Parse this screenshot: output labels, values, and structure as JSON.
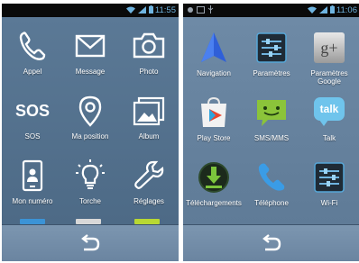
{
  "left_phone": {
    "status_time": "11:55",
    "apps": [
      {
        "label": "Appel",
        "icon": "phone-icon"
      },
      {
        "label": "Message",
        "icon": "envelope-icon"
      },
      {
        "label": "Photo",
        "icon": "camera-icon"
      },
      {
        "label": "SOS",
        "icon": "sos-icon"
      },
      {
        "label": "Ma position",
        "icon": "location-pin-icon"
      },
      {
        "label": "Album",
        "icon": "album-icon"
      },
      {
        "label": "Mon numéro",
        "icon": "contact-card-icon"
      },
      {
        "label": "Torche",
        "icon": "lightbulb-icon"
      },
      {
        "label": "Réglages",
        "icon": "wrench-icon"
      }
    ],
    "sos_glyph": "SOS",
    "partial_colors": [
      "#3b93d6",
      "#d8d8d8",
      "#b8d832"
    ]
  },
  "right_phone": {
    "status_time": "11:06",
    "apps": [
      {
        "label": "Navigation",
        "icon": "navigation-arrow-icon"
      },
      {
        "label": "Paramètres",
        "icon": "settings-sliders-icon"
      },
      {
        "label": "Paramètres Google",
        "icon": "google-settings-icon"
      },
      {
        "label": "Play Store",
        "icon": "play-store-icon"
      },
      {
        "label": "SMS/MMS",
        "icon": "sms-icon"
      },
      {
        "label": "Talk",
        "icon": "talk-icon"
      },
      {
        "label": "Téléchargements",
        "icon": "download-icon"
      },
      {
        "label": "Téléphone",
        "icon": "phone-handset-icon"
      },
      {
        "label": "Wi-Fi",
        "icon": "wifi-settings-icon"
      }
    ],
    "google_glyph": "g+",
    "talk_glyph": "talk"
  },
  "colors": {
    "status_text": "#6fb4e0",
    "screen_left": "#5b7996",
    "screen_right": "#6e8aa6"
  }
}
